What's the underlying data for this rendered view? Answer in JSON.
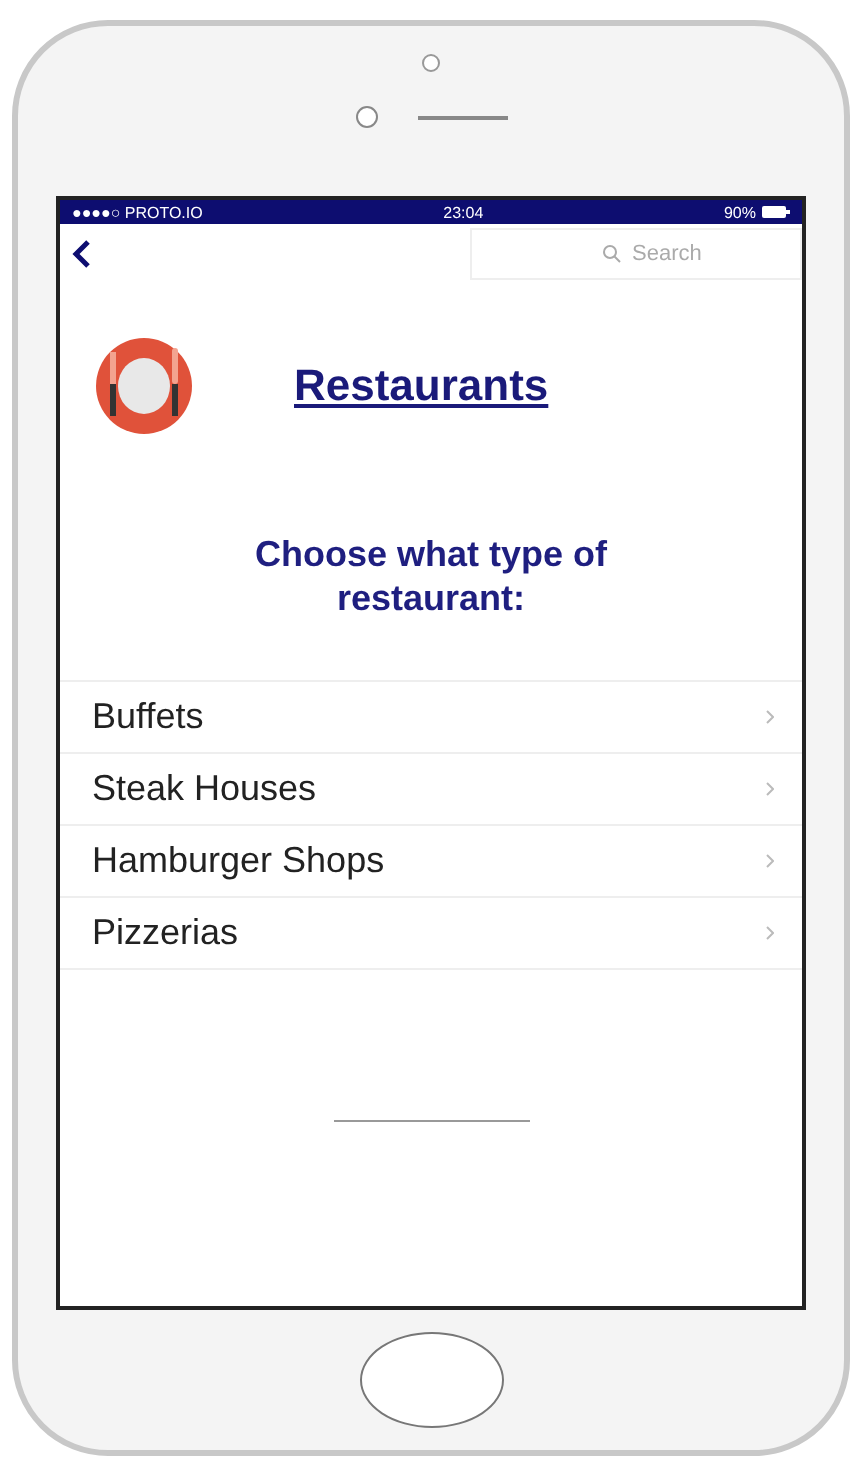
{
  "status_bar": {
    "carrier": "●●●●○ PROTO.IO",
    "time": "23:04",
    "battery": "90%"
  },
  "search": {
    "placeholder": "Search"
  },
  "title": "Restaurants",
  "heading": "Choose what type of restaurant:",
  "items": [
    {
      "label": "Buffets"
    },
    {
      "label": "Steak Houses"
    },
    {
      "label": "Hamburger Shops"
    },
    {
      "label": "Pizzerias"
    }
  ]
}
